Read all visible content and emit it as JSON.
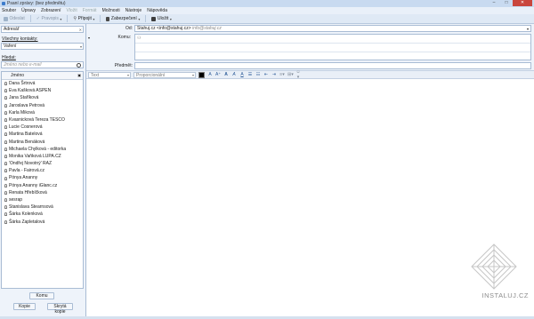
{
  "window": {
    "title": "Psaní zprávy: (bez předmětu)",
    "buttons": [
      "–",
      "□",
      "✕"
    ]
  },
  "menu": [
    {
      "label": "Soubor",
      "dim": false
    },
    {
      "label": "Úpravy",
      "dim": false
    },
    {
      "label": "Zobrazení",
      "dim": false
    },
    {
      "label": "Vložit",
      "dim": true
    },
    {
      "label": "Formát",
      "dim": true
    },
    {
      "label": "Možnosti",
      "dim": false
    },
    {
      "label": "Nástroje",
      "dim": false
    },
    {
      "label": "Nápověda",
      "dim": false
    }
  ],
  "toolbar": {
    "send": "Odeslat",
    "spell": "Pravopis",
    "attach": "Připojit",
    "security": "Zabezpečení",
    "save": "Uložit"
  },
  "sidebar": {
    "address_book": "Adresář",
    "all_contacts_label": "Všechny kontakty:",
    "group_value": "Vaření",
    "search_label": "Hledat:",
    "search_placeholder": "Jméno nebo e-mail",
    "column_name": "Jméno",
    "contacts": [
      "Dana Šrtrová",
      "Eva Kašková ASPEN",
      "Jana Staříková",
      "Jaroslava Petrová",
      "Karla Miková",
      "Kvasnicková Tereza TESCO",
      "Lucie Cosnerová",
      "Martina Batelová",
      "Martina Benáková",
      "Michaela Chylková - editorka",
      "Monika Vaňková LUPA.CZ",
      "'Ondřej Novotný' RAZ",
      "Pavla - Fairová.cz",
      "Pónya Ananny",
      "Pónya Ananny iGlanc.cz",
      "Renata Hřebíčková",
      "sesrap",
      "Stanislava Stearnsová",
      "Šárka Kolenková",
      "Šárka Zapletalová"
    ],
    "btn_to": "Komu",
    "btn_cc": "Kopie",
    "btn_bcc": "Skrytá kopie"
  },
  "header": {
    "from_label": "Od:",
    "from_value": "Stahuj.cz <info@stahuj.cz>",
    "from_sub": " info@stahuj.cz",
    "to_label": "Komu:",
    "subject_label": "Předmět:"
  },
  "format": {
    "text_style": "Text",
    "font": "Proporcionální"
  },
  "watermark": "INSTALUJ.CZ"
}
